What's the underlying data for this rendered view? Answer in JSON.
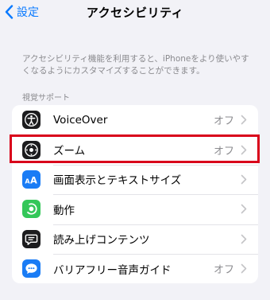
{
  "nav": {
    "back_label": "設定",
    "title": "アクセシビリティ"
  },
  "description": "アクセシビリティ機能を利用すると、iPhoneをより使いやすくなるようにカスタマイズすることができます。",
  "section_header": "視覚サポート",
  "rows": [
    {
      "label": "VoiceOver",
      "value": "オフ",
      "icon": "voiceover-icon",
      "icon_color": "#1c1c1e"
    },
    {
      "label": "ズーム",
      "value": "オフ",
      "icon": "zoom-icon",
      "icon_color": "#1c1c1e"
    },
    {
      "label": "画面表示とテキストサイズ",
      "value": "",
      "icon": "text-size-icon",
      "icon_color": "#1a7cf5"
    },
    {
      "label": "動作",
      "value": "",
      "icon": "motion-icon",
      "icon_color": "#34c759"
    },
    {
      "label": "読み上げコンテンツ",
      "value": "",
      "icon": "spoken-content-icon",
      "icon_color": "#1c1c1e"
    },
    {
      "label": "バリアフリー音声ガイド",
      "value": "オフ",
      "icon": "audio-descriptions-icon",
      "icon_color": "#1a7cf5"
    }
  ],
  "colors": {
    "accent": "#0a7aff",
    "highlight_frame": "#d9021b"
  }
}
